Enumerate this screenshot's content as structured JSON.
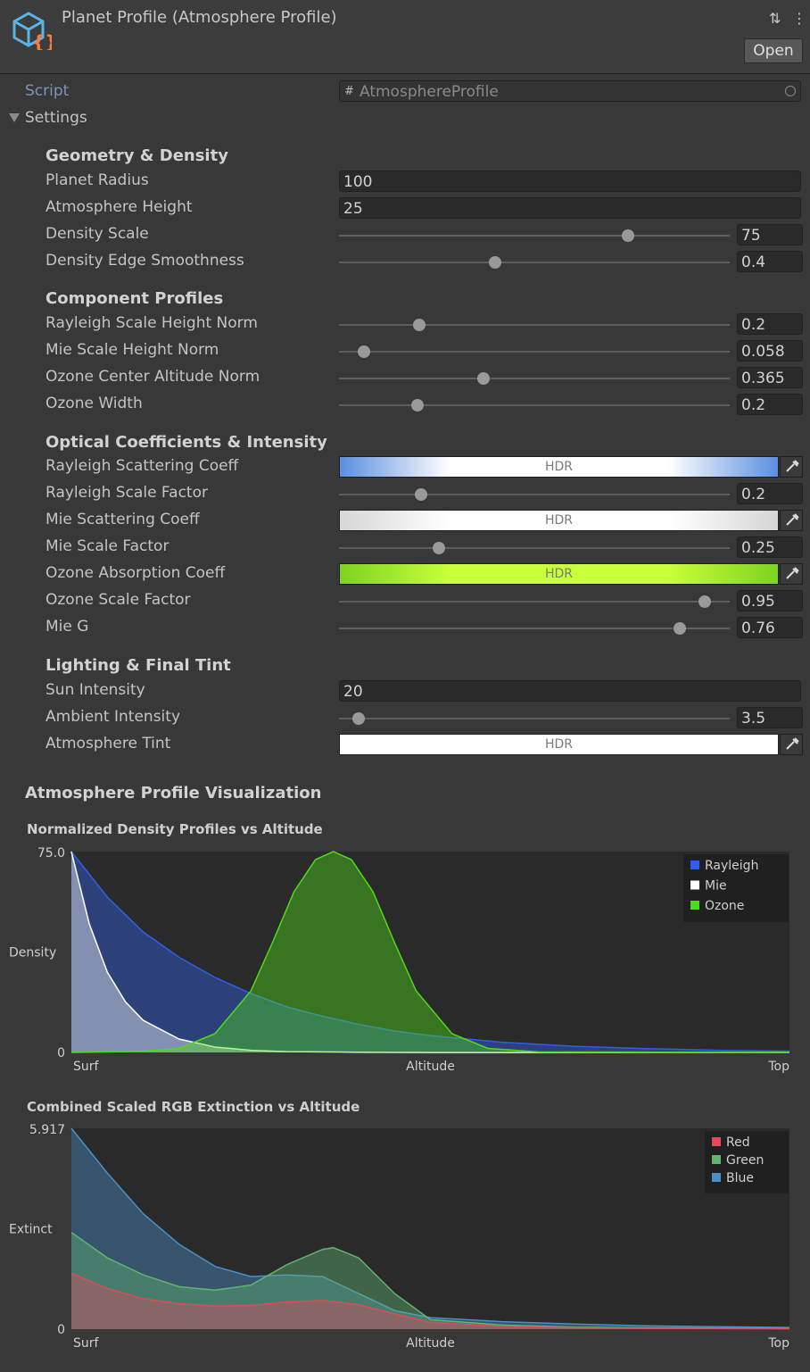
{
  "header": {
    "title": "Planet Profile (Atmosphere Profile)",
    "open_label": "Open",
    "sliders_icon": "⇅",
    "menu_icon": "⋮"
  },
  "script_row": {
    "label": "Script",
    "value": "AtmosphereProfile",
    "hash": "#"
  },
  "settings": {
    "label": "Settings"
  },
  "sections": {
    "geometry": "Geometry & Density",
    "components": "Component Profiles",
    "optical": "Optical Coefficients & Intensity",
    "lighting": "Lighting & Final Tint"
  },
  "fields": {
    "planet_radius": {
      "label": "Planet Radius",
      "value": "100"
    },
    "atmosphere_height": {
      "label": "Atmosphere Height",
      "value": "25"
    },
    "density_scale": {
      "label": "Density Scale",
      "value": "75",
      "slider": 0.74
    },
    "density_edge": {
      "label": "Density Edge Smoothness",
      "value": "0.4",
      "slider": 0.4
    },
    "rayleigh_height": {
      "label": "Rayleigh Scale Height Norm",
      "value": "0.2",
      "slider": 0.205
    },
    "mie_height": {
      "label": "Mie Scale Height Norm",
      "value": "0.058",
      "slider": 0.063
    },
    "ozone_center": {
      "label": "Ozone Center Altitude Norm",
      "value": "0.365",
      "slider": 0.37
    },
    "ozone_width": {
      "label": "Ozone Width",
      "value": "0.2",
      "slider": 0.2
    },
    "rayleigh_coeff": {
      "label": "Rayleigh Scattering Coeff",
      "value": "HDR"
    },
    "rayleigh_factor": {
      "label": "Rayleigh Scale Factor",
      "value": "0.2",
      "slider": 0.21
    },
    "mie_coeff": {
      "label": "Mie Scattering Coeff",
      "value": "HDR"
    },
    "mie_factor": {
      "label": "Mie Scale Factor",
      "value": "0.25",
      "slider": 0.255
    },
    "ozone_coeff": {
      "label": "Ozone Absorption Coeff",
      "value": "HDR"
    },
    "ozone_factor": {
      "label": "Ozone Scale Factor",
      "value": "0.95",
      "slider": 0.935
    },
    "mie_g": {
      "label": "Mie G",
      "value": "0.76",
      "slider": 0.872
    },
    "sun_intensity": {
      "label": "Sun Intensity",
      "value": "20"
    },
    "ambient_intensity": {
      "label": "Ambient Intensity",
      "value": "3.5",
      "slider": 0.05
    },
    "atmosphere_tint": {
      "label": "Atmosphere Tint",
      "value": "HDR"
    }
  },
  "colors": {
    "rayleigh_gradient": [
      "#5b8fe0",
      "#ffffff",
      "#5b8fe0"
    ],
    "mie_gradient": [
      "#d6d6d6",
      "#ffffff",
      "#d6d6d6"
    ],
    "ozone_gradient": [
      "#7ed320",
      "#c8ff3a",
      "#7ed320"
    ],
    "tint": "#ffffff"
  },
  "visualization": {
    "title": "Atmosphere Profile Visualization"
  },
  "chart_data": [
    {
      "type": "area",
      "title": "Normalized Density Profiles vs Altitude",
      "xlabel": "Altitude",
      "ylabel": "Density",
      "x_tick_labels": [
        "Surf",
        "Top"
      ],
      "y_tick_labels": [
        "75.0",
        "0"
      ],
      "ylim": [
        0,
        75
      ],
      "xlim": [
        0,
        1
      ],
      "legend": "top-right",
      "series": [
        {
          "name": "Rayleigh",
          "color": "#2f5fe8",
          "x": [
            0,
            0.05,
            0.1,
            0.15,
            0.2,
            0.25,
            0.3,
            0.35,
            0.4,
            0.45,
            0.5,
            0.6,
            0.7,
            0.8,
            0.9,
            1.0
          ],
          "values": [
            75,
            58,
            45,
            35.5,
            28,
            22,
            17,
            13.5,
            10.5,
            8,
            6.3,
            3.8,
            2.3,
            1.4,
            0.8,
            0.5
          ]
        },
        {
          "name": "Mie",
          "color": "#ffffff",
          "x": [
            0,
            0.025,
            0.05,
            0.075,
            0.1,
            0.15,
            0.2,
            0.25,
            0.3,
            0.4,
            0.5,
            1.0
          ],
          "values": [
            75,
            48,
            30,
            19,
            12,
            5,
            2,
            0.8,
            0.3,
            0.1,
            0,
            0
          ]
        },
        {
          "name": "Ozone",
          "color": "#4fdc18",
          "x": [
            0,
            0.1,
            0.15,
            0.2,
            0.25,
            0.28,
            0.31,
            0.34,
            0.365,
            0.39,
            0.42,
            0.45,
            0.48,
            0.53,
            0.58,
            0.65,
            1.0
          ],
          "values": [
            0,
            0.4,
            1.5,
            7,
            23,
            41,
            60,
            72,
            75,
            72,
            60,
            41,
            23,
            7,
            1.5,
            0.2,
            0
          ]
        }
      ]
    },
    {
      "type": "area",
      "title": "Combined Scaled RGB Extinction vs Altitude",
      "xlabel": "Altitude",
      "ylabel": "Extinct",
      "x_tick_labels": [
        "Surf",
        "Top"
      ],
      "y_tick_labels": [
        "5.917",
        "0"
      ],
      "ylim": [
        0,
        5.917
      ],
      "xlim": [
        0,
        1
      ],
      "legend": "top-right",
      "series": [
        {
          "name": "Blue",
          "color": "#4a8fc8",
          "x": [
            0,
            0.05,
            0.1,
            0.15,
            0.2,
            0.25,
            0.3,
            0.35,
            0.4,
            0.45,
            0.5,
            0.6,
            0.7,
            0.8,
            0.9,
            1.0
          ],
          "values": [
            5.917,
            4.6,
            3.4,
            2.5,
            1.85,
            1.55,
            1.6,
            1.55,
            1.05,
            0.55,
            0.34,
            0.22,
            0.15,
            0.1,
            0.07,
            0.05
          ]
        },
        {
          "name": "Green",
          "color": "#5fb570",
          "x": [
            0,
            0.05,
            0.1,
            0.15,
            0.2,
            0.25,
            0.3,
            0.35,
            0.365,
            0.4,
            0.45,
            0.5,
            0.6,
            0.7,
            0.8,
            1.0
          ],
          "values": [
            2.85,
            2.1,
            1.6,
            1.25,
            1.15,
            1.3,
            1.9,
            2.35,
            2.4,
            2.1,
            1.05,
            0.28,
            0.12,
            0.06,
            0.04,
            0.02
          ]
        },
        {
          "name": "Red",
          "color": "#e04a5a",
          "x": [
            0,
            0.05,
            0.1,
            0.15,
            0.2,
            0.25,
            0.3,
            0.35,
            0.4,
            0.45,
            0.5,
            0.6,
            0.7,
            0.8,
            1.0
          ],
          "values": [
            1.65,
            1.2,
            0.9,
            0.75,
            0.68,
            0.7,
            0.8,
            0.85,
            0.72,
            0.45,
            0.2,
            0.08,
            0.04,
            0.02,
            0.01
          ]
        }
      ]
    }
  ]
}
